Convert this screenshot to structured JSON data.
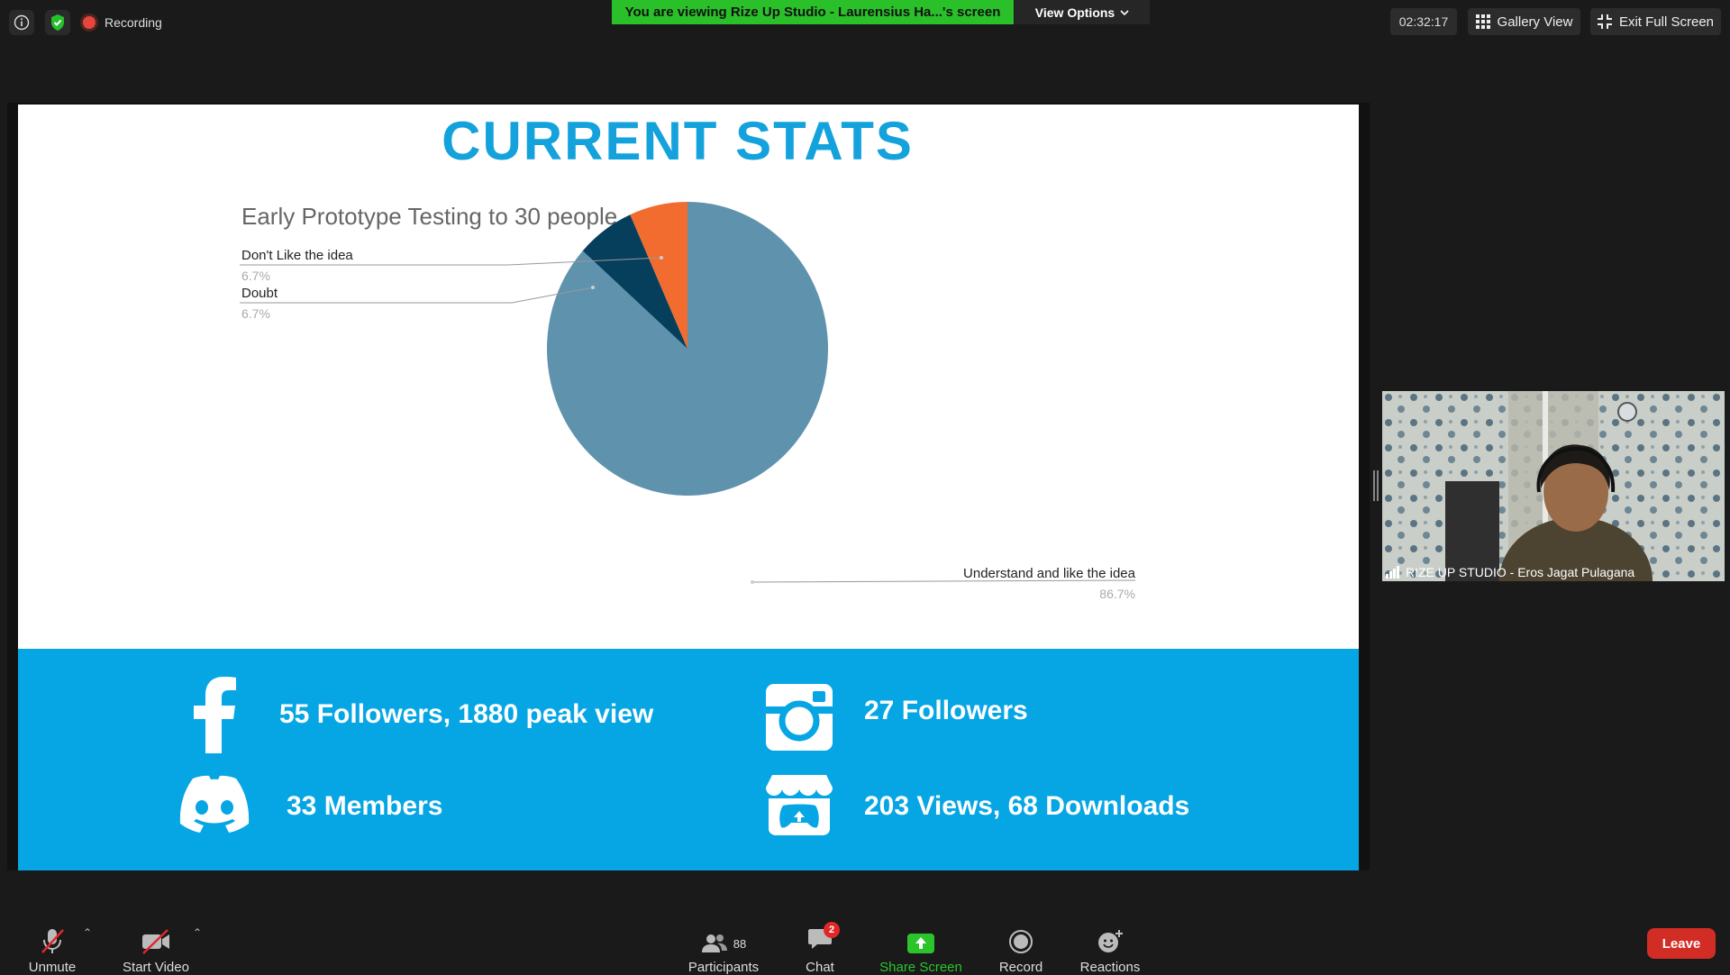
{
  "meeting": {
    "recording_label": "Recording",
    "viewing_banner": "You are viewing Rize Up Studio - Laurensius Ha...'s screen",
    "view_options_label": "View Options",
    "elapsed_time": "02:32:17",
    "gallery_view_label": "Gallery View",
    "exit_fullscreen_label": "Exit Full Screen"
  },
  "slide": {
    "title": "CURRENT STATS",
    "stats": {
      "facebook": "55 Followers, 1880 peak view",
      "instagram": "27 Followers",
      "discord": "33 Members",
      "itchio": "203 Views, 68 Downloads"
    }
  },
  "chart_data": {
    "type": "pie",
    "title": "Early Prototype Testing to 30 people",
    "slices": [
      {
        "label": "Understand and like the idea",
        "value": 86.7,
        "display": "86.7%",
        "color": "#5f92ad"
      },
      {
        "label": "Doubt",
        "value": 6.7,
        "display": "6.7%",
        "color": "#063f5c"
      },
      {
        "label": "Don't Like the idea",
        "value": 6.7,
        "display": "6.7%",
        "color": "#f26b2f"
      }
    ]
  },
  "participant": {
    "name": "RIZE UP STUDIO - Eros Jagat Pulagana"
  },
  "toolbar": {
    "unmute": "Unmute",
    "start_video": "Start Video",
    "participants": "Participants",
    "participants_count": "88",
    "chat": "Chat",
    "chat_badge": "2",
    "share_screen": "Share Screen",
    "record": "Record",
    "reactions": "Reactions",
    "leave": "Leave"
  },
  "colors": {
    "banner_green": "#2ac02a",
    "stats_blue": "#06a6e4",
    "title_blue": "#14a2dc",
    "leave_red": "#d22d25"
  }
}
